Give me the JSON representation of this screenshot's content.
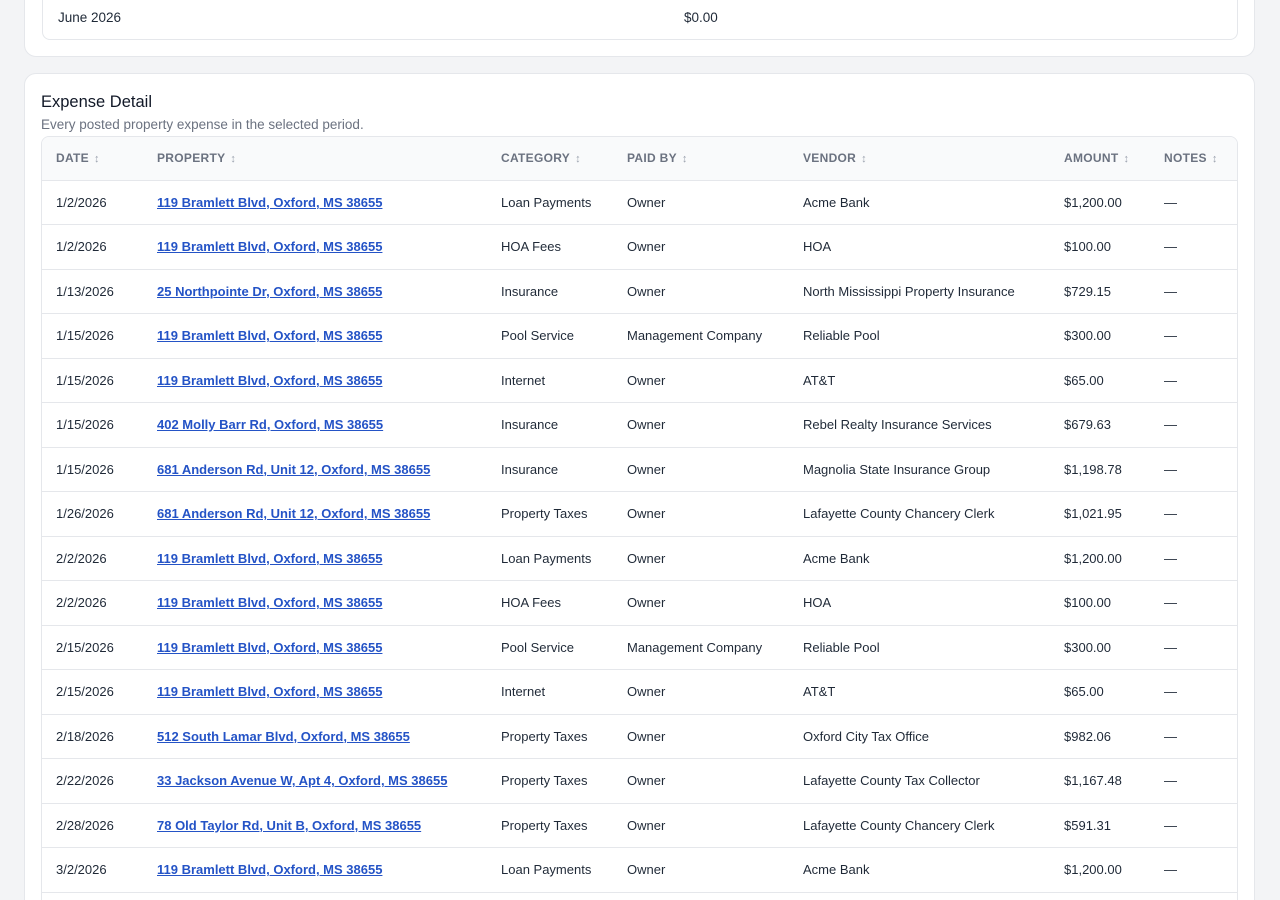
{
  "monthly_summary": {
    "last_row": {
      "month": "June 2026",
      "amount": "$0.00"
    }
  },
  "expense_detail": {
    "title": "Expense Detail",
    "subtitle": "Every posted property expense in the selected period.",
    "sort_glyph": "↕",
    "columns": [
      "DATE",
      "PROPERTY",
      "CATEGORY",
      "PAID BY",
      "VENDOR",
      "AMOUNT",
      "NOTES"
    ],
    "rows": [
      {
        "date": "1/2/2026",
        "property": "119 Bramlett Blvd, Oxford, MS 38655",
        "category": "Loan Payments",
        "paid_by": "Owner",
        "vendor": "Acme Bank",
        "amount": "$1,200.00",
        "notes": "—"
      },
      {
        "date": "1/2/2026",
        "property": "119 Bramlett Blvd, Oxford, MS 38655",
        "category": "HOA Fees",
        "paid_by": "Owner",
        "vendor": "HOA",
        "amount": "$100.00",
        "notes": "—"
      },
      {
        "date": "1/13/2026",
        "property": "25 Northpointe Dr, Oxford, MS 38655",
        "category": "Insurance",
        "paid_by": "Owner",
        "vendor": "North Mississippi Property Insurance",
        "amount": "$729.15",
        "notes": "—"
      },
      {
        "date": "1/15/2026",
        "property": "119 Bramlett Blvd, Oxford, MS 38655",
        "category": "Pool Service",
        "paid_by": "Management Company",
        "vendor": "Reliable Pool",
        "amount": "$300.00",
        "notes": "—"
      },
      {
        "date": "1/15/2026",
        "property": "119 Bramlett Blvd, Oxford, MS 38655",
        "category": "Internet",
        "paid_by": "Owner",
        "vendor": "AT&T",
        "amount": "$65.00",
        "notes": "—"
      },
      {
        "date": "1/15/2026",
        "property": "402 Molly Barr Rd, Oxford, MS 38655",
        "category": "Insurance",
        "paid_by": "Owner",
        "vendor": "Rebel Realty Insurance Services",
        "amount": "$679.63",
        "notes": "—"
      },
      {
        "date": "1/15/2026",
        "property": "681 Anderson Rd, Unit 12, Oxford, MS 38655",
        "category": "Insurance",
        "paid_by": "Owner",
        "vendor": "Magnolia State Insurance Group",
        "amount": "$1,198.78",
        "notes": "—"
      },
      {
        "date": "1/26/2026",
        "property": "681 Anderson Rd, Unit 12, Oxford, MS 38655",
        "category": "Property Taxes",
        "paid_by": "Owner",
        "vendor": "Lafayette County Chancery Clerk",
        "amount": "$1,021.95",
        "notes": "—"
      },
      {
        "date": "2/2/2026",
        "property": "119 Bramlett Blvd, Oxford, MS 38655",
        "category": "Loan Payments",
        "paid_by": "Owner",
        "vendor": "Acme Bank",
        "amount": "$1,200.00",
        "notes": "—"
      },
      {
        "date": "2/2/2026",
        "property": "119 Bramlett Blvd, Oxford, MS 38655",
        "category": "HOA Fees",
        "paid_by": "Owner",
        "vendor": "HOA",
        "amount": "$100.00",
        "notes": "—"
      },
      {
        "date": "2/15/2026",
        "property": "119 Bramlett Blvd, Oxford, MS 38655",
        "category": "Pool Service",
        "paid_by": "Management Company",
        "vendor": "Reliable Pool",
        "amount": "$300.00",
        "notes": "—"
      },
      {
        "date": "2/15/2026",
        "property": "119 Bramlett Blvd, Oxford, MS 38655",
        "category": "Internet",
        "paid_by": "Owner",
        "vendor": "AT&T",
        "amount": "$65.00",
        "notes": "—"
      },
      {
        "date": "2/18/2026",
        "property": "512 South Lamar Blvd, Oxford, MS 38655",
        "category": "Property Taxes",
        "paid_by": "Owner",
        "vendor": "Oxford City Tax Office",
        "amount": "$982.06",
        "notes": "—"
      },
      {
        "date": "2/22/2026",
        "property": "33 Jackson Avenue W, Apt 4, Oxford, MS 38655",
        "category": "Property Taxes",
        "paid_by": "Owner",
        "vendor": "Lafayette County Tax Collector",
        "amount": "$1,167.48",
        "notes": "—"
      },
      {
        "date": "2/28/2026",
        "property": "78 Old Taylor Rd, Unit B, Oxford, MS 38655",
        "category": "Property Taxes",
        "paid_by": "Owner",
        "vendor": "Lafayette County Chancery Clerk",
        "amount": "$591.31",
        "notes": "—"
      },
      {
        "date": "3/2/2026",
        "property": "119 Bramlett Blvd, Oxford, MS 38655",
        "category": "Loan Payments",
        "paid_by": "Owner",
        "vendor": "Acme Bank",
        "amount": "$1,200.00",
        "notes": "—"
      }
    ]
  },
  "colors": {
    "link": "#2453c6",
    "border": "#e5e7eb",
    "header_bg": "#f9fafb",
    "page_bg": "#f3f4f6"
  }
}
